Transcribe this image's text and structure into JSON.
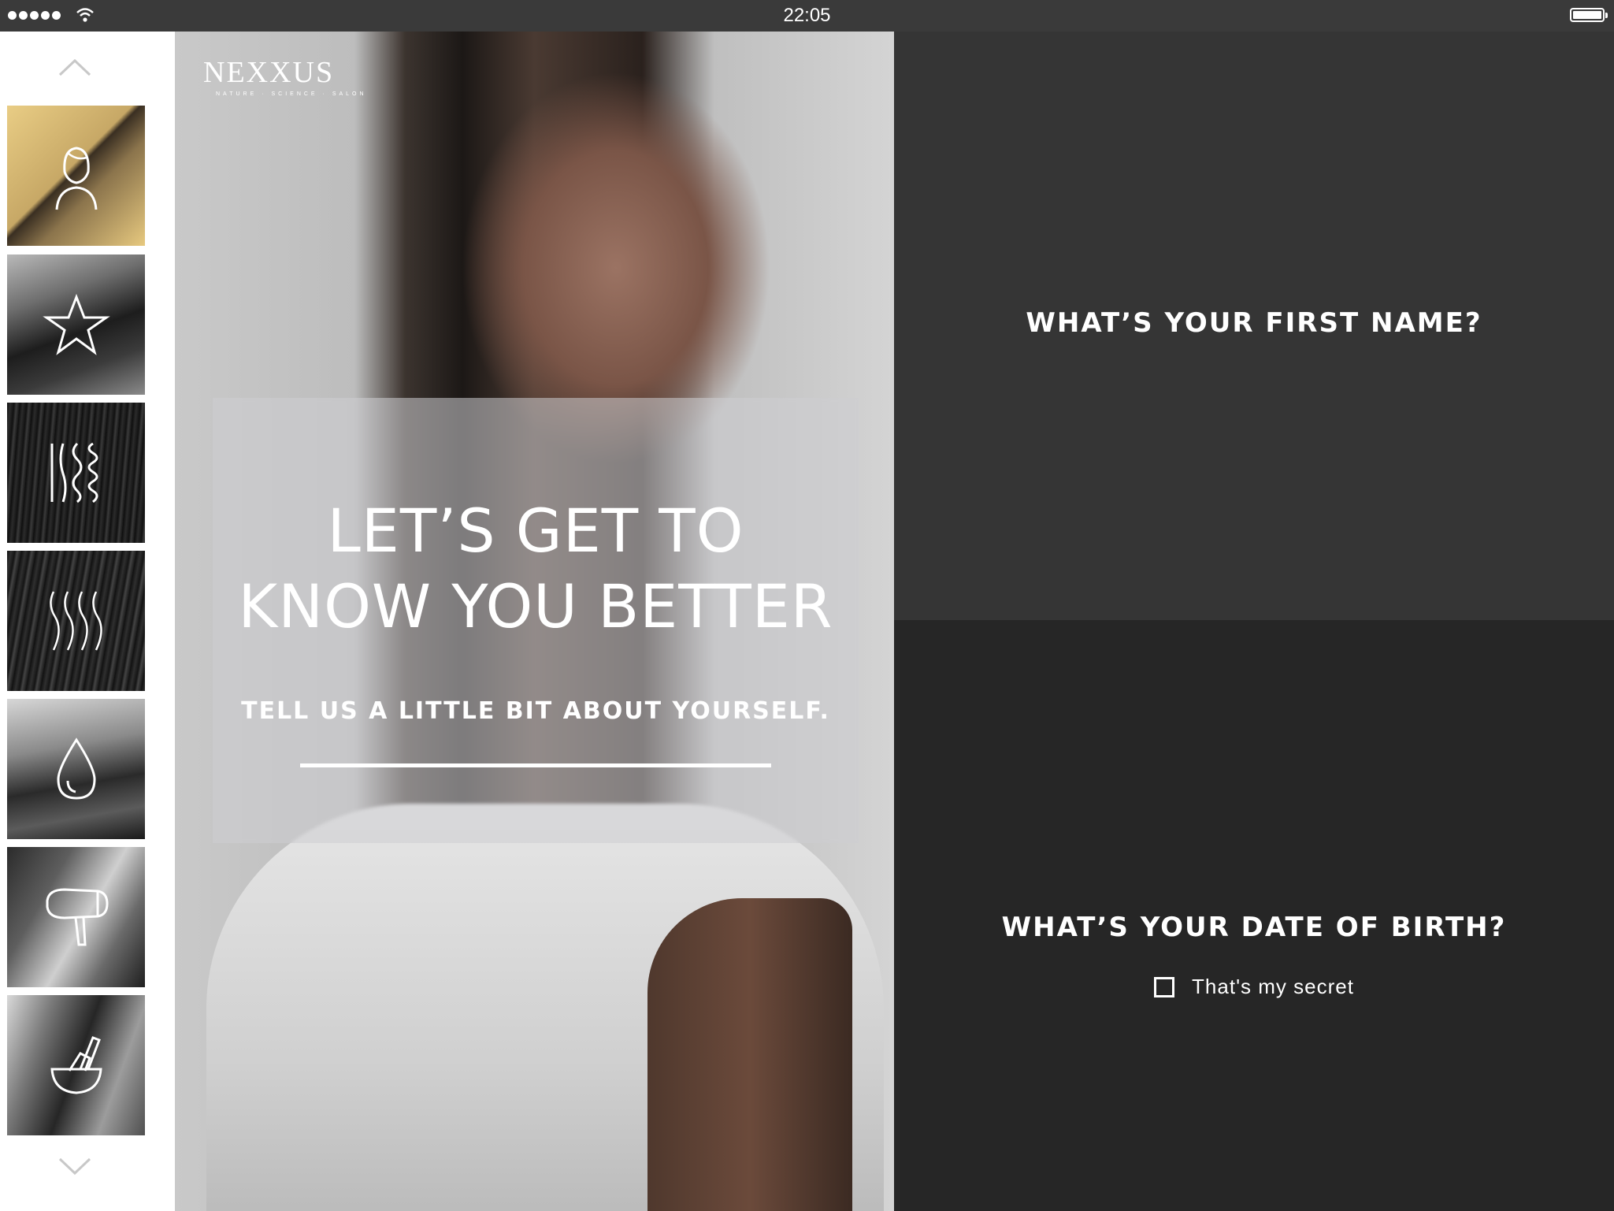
{
  "status_bar": {
    "time": "22:05"
  },
  "sidebar": {
    "items": [
      {
        "icon": "woman-profile-icon"
      },
      {
        "icon": "star-icon"
      },
      {
        "icon": "hair-texture-icon"
      },
      {
        "icon": "hair-wave-icon"
      },
      {
        "icon": "water-drop-icon"
      },
      {
        "icon": "hair-dryer-icon"
      },
      {
        "icon": "brush-bowl-icon"
      }
    ]
  },
  "hero": {
    "logo": "NEXXUS",
    "logo_tagline": "NATURE · SCIENCE · SALON",
    "headline_line1": "LET’S GET TO",
    "headline_line2": "KNOW YOU BETTER",
    "subline": "TELL US A LITTLE BIT ABOUT YOURSELF."
  },
  "form": {
    "first_name_question": "WHAT’S YOUR FIRST NAME?",
    "dob_question": "WHAT’S YOUR DATE OF BIRTH?",
    "secret_label": "That's my secret",
    "secret_checked": false
  },
  "colors": {
    "panel_top": "#353535",
    "panel_bottom": "#262626"
  }
}
